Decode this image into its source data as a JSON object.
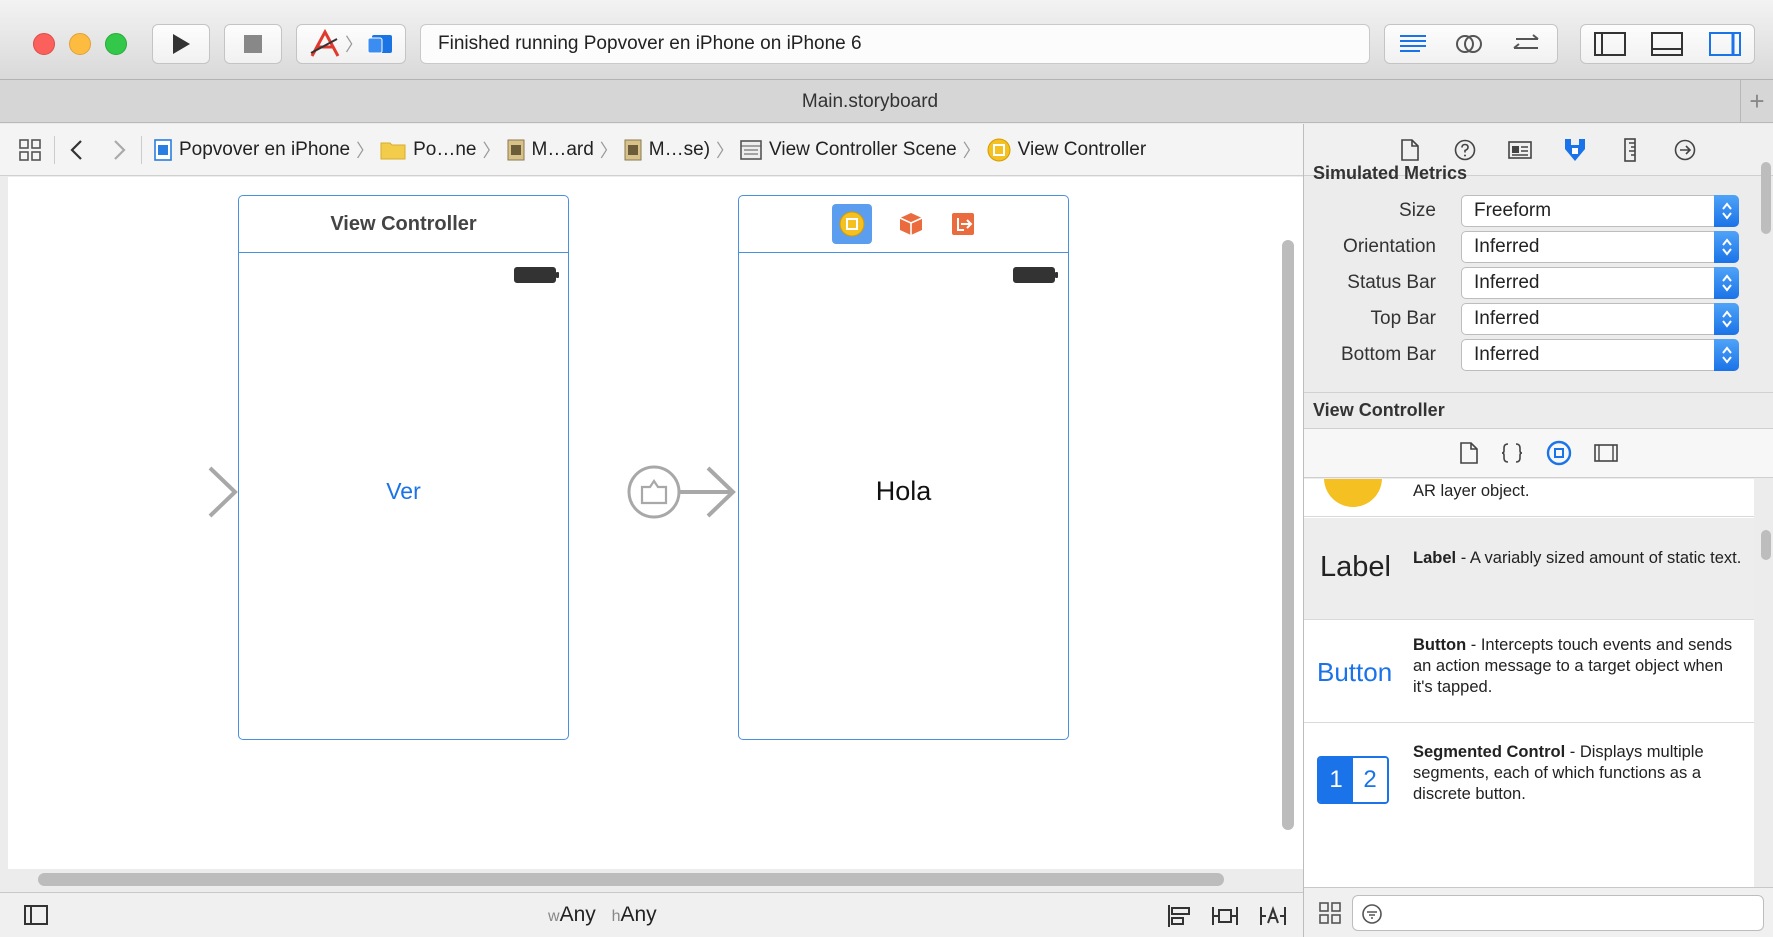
{
  "toolbar": {
    "activity_text": "Finished running Popvover en iPhone on iPhone 6",
    "icons": [
      "run-icon",
      "stop-icon",
      "scheme-icon",
      "device-icon",
      "standard-editor-icon",
      "assistant-editor-icon",
      "version-editor-icon",
      "navigator-toggle-icon",
      "debug-area-toggle-icon",
      "utilities-toggle-icon"
    ]
  },
  "tab": {
    "title": "Main.storyboard",
    "add": "+"
  },
  "jumpbar": {
    "crumbs": [
      "Popvover en iPhone",
      "Po…ne",
      "M…ard",
      "M…se)",
      "View Controller Scene",
      "View Controller"
    ]
  },
  "canvas": {
    "scene1": {
      "title": "View Controller",
      "button_text": "Ver"
    },
    "scene2": {
      "label_text": "Hola"
    },
    "accent_color": "#4a90e2"
  },
  "footer": {
    "size_class_w_prefix": "w",
    "size_class_w": "Any",
    "size_class_h_prefix": "h",
    "size_class_h": "Any"
  },
  "inspector": {
    "simulated_metrics": {
      "title": "Simulated Metrics",
      "rows": [
        {
          "label": "Size",
          "value": "Freeform"
        },
        {
          "label": "Orientation",
          "value": "Inferred"
        },
        {
          "label": "Status Bar",
          "value": "Inferred"
        },
        {
          "label": "Top Bar",
          "value": "Inferred"
        },
        {
          "label": "Bottom Bar",
          "value": "Inferred"
        }
      ]
    },
    "view_controller_title": "View Controller",
    "library": [
      {
        "preview": "Label",
        "name": "Label",
        "desc": " - A variably sized amount of static text."
      },
      {
        "preview": "Button",
        "name": "Button",
        "desc": " - Intercepts touch events and sends an action message to a target object when it's tapped."
      },
      {
        "preview_1": "1",
        "preview_2": "2",
        "name": "Segmented Control",
        "desc": " - Displays multiple segments, each of which functions as a discrete button."
      }
    ],
    "partial_item_text": "AR layer object."
  }
}
